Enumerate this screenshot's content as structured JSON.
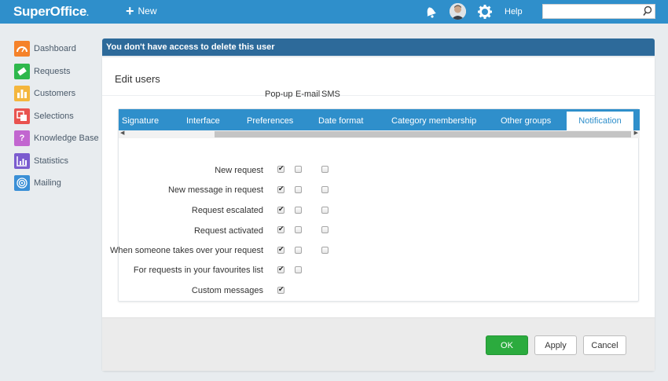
{
  "header": {
    "logo": "SuperOffice",
    "logo_dot": ".",
    "new_label": "New",
    "help_label": "Help",
    "search_value": "",
    "icons": [
      "bell-icon",
      "avatar",
      "gear-icon",
      "search-icon"
    ]
  },
  "sidebar": {
    "items": [
      {
        "label": "Dashboard",
        "icon": "dashboard-icon",
        "color": "#f5822a"
      },
      {
        "label": "Requests",
        "icon": "ticket-icon",
        "color": "#2eb84c"
      },
      {
        "label": "Customers",
        "icon": "customers-icon",
        "color": "#f4b63d"
      },
      {
        "label": "Selections",
        "icon": "selections-icon",
        "color": "#e9534f"
      },
      {
        "label": "Knowledge Base",
        "icon": "question-icon",
        "color": "#c266d0"
      },
      {
        "label": "Statistics",
        "icon": "chart-icon",
        "color": "#7b5ccf"
      },
      {
        "label": "Mailing",
        "icon": "target-icon",
        "color": "#3a8fd6"
      }
    ]
  },
  "banner": {
    "text": "You don't have access to delete this user"
  },
  "dialog": {
    "title": "Edit users",
    "tabs": [
      "Signature",
      "Interface",
      "Preferences",
      "Date format",
      "Category membership",
      "Other groups",
      "Notification"
    ],
    "active_tab": "Notification",
    "columns": [
      "Pop-up",
      "E-mail",
      "SMS"
    ],
    "rows": [
      {
        "label": "New request",
        "popup": true,
        "email": false,
        "sms": false
      },
      {
        "label": "New message in request",
        "popup": true,
        "email": false,
        "sms": false
      },
      {
        "label": "Request escalated",
        "popup": true,
        "email": false,
        "sms": false
      },
      {
        "label": "Request activated",
        "popup": true,
        "email": false,
        "sms": false
      },
      {
        "label": "When someone takes over your request",
        "popup": true,
        "email": false,
        "sms": false
      },
      {
        "label": "For requests in your favourites list",
        "popup": true,
        "email": false,
        "sms": null
      },
      {
        "label": "Custom messages",
        "popup": true,
        "email": null,
        "sms": null
      }
    ]
  },
  "buttons": {
    "ok": "OK",
    "apply": "Apply",
    "cancel": "Cancel"
  },
  "colors": {
    "accent": "#2f8fcb",
    "banner": "#2d6a9a",
    "ok_green": "#2bab3e"
  }
}
